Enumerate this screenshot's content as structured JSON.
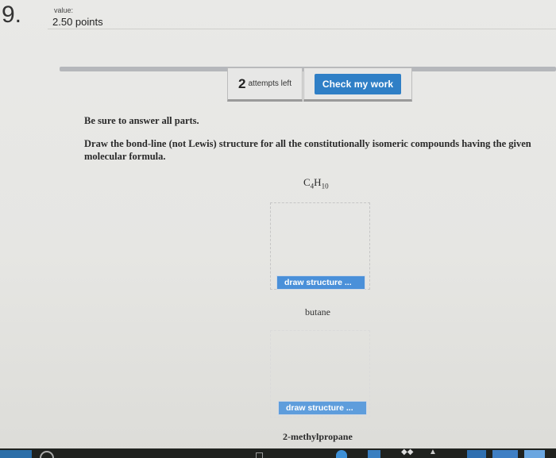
{
  "question": {
    "number": "9.",
    "value_label": "value:",
    "value_points": "2.50 points"
  },
  "toolbar": {
    "attempts_count": "2",
    "attempts_label": "attempts left",
    "check_button_label": "Check my work"
  },
  "content": {
    "instruction_1": "Be sure to answer all parts.",
    "instruction_2": "Draw the bond-line (not Lewis) structure for all the constitutionally isomeric compounds having the given molecular formula.",
    "formula": {
      "c": "C",
      "c_sub": "4",
      "h": "H",
      "h_sub": "10"
    },
    "answers": [
      {
        "draw_button_label": "draw structure ...",
        "compound_name": "butane"
      },
      {
        "draw_button_label": "draw structure ...",
        "compound_name": "2-methylpropane"
      }
    ]
  },
  "colors": {
    "check_button": "#2f7fc6",
    "draw_button": "#4a90d9",
    "background": "#e8e8e6"
  }
}
